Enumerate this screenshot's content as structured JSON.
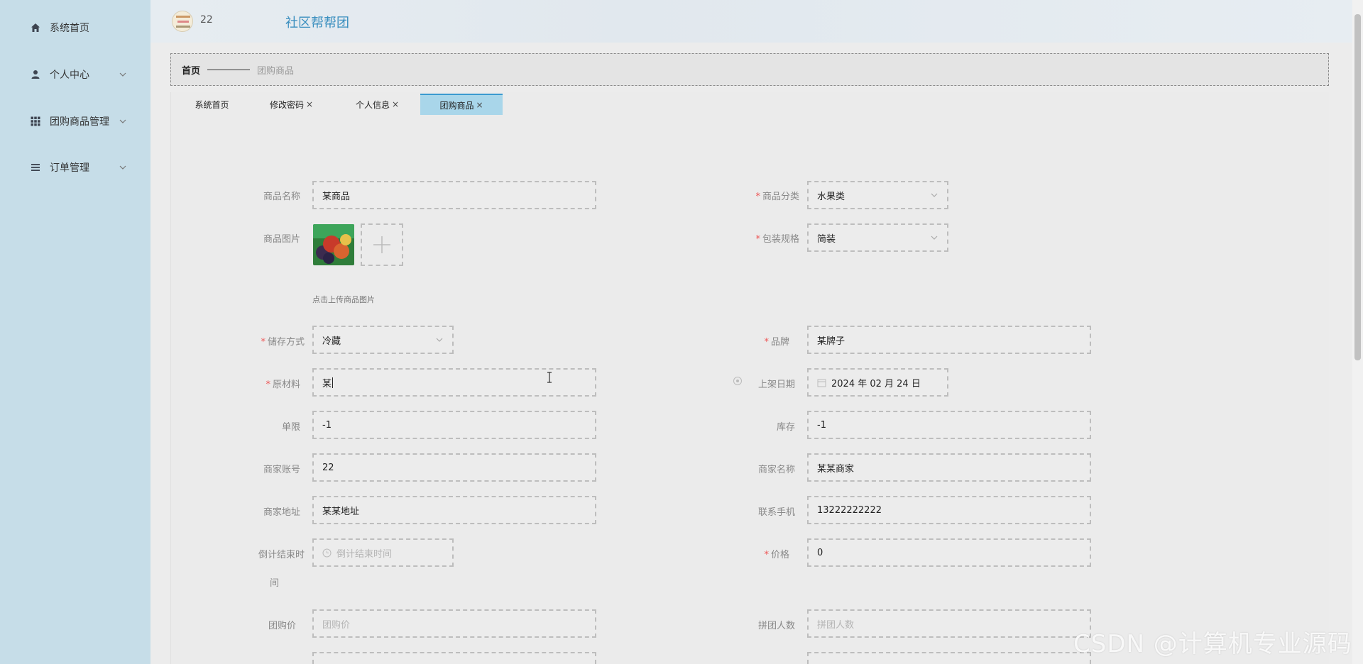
{
  "sidebar": {
    "items": [
      {
        "label": "系统首页",
        "icon": "home-icon"
      },
      {
        "label": "个人中心",
        "icon": "user-icon"
      },
      {
        "label": "团购商品管理",
        "icon": "grid-icon"
      },
      {
        "label": "订单管理",
        "icon": "list-icon"
      }
    ]
  },
  "header": {
    "username": "22",
    "app_title": "社区帮帮团"
  },
  "breadcrumb": {
    "home": "首页",
    "current": "团购商品"
  },
  "tabs": [
    {
      "label": "系统首页",
      "closable": false,
      "active": false
    },
    {
      "label": "修改密码",
      "closable": true,
      "active": false
    },
    {
      "label": "个人信息",
      "closable": true,
      "active": false
    },
    {
      "label": "团购商品",
      "closable": true,
      "active": true
    }
  ],
  "tab_close_glyph": "×",
  "form": {
    "product_name": {
      "label": "商品名称",
      "value": "某商品"
    },
    "category": {
      "label": "商品分类",
      "value": "水果类"
    },
    "image": {
      "label": "商品图片",
      "upload_hint": "点击上传商品图片"
    },
    "packaging": {
      "label": "包装规格",
      "value": "简装"
    },
    "storage": {
      "label": "储存方式",
      "value": "冷藏"
    },
    "brand": {
      "label": "品牌",
      "value": "某牌子"
    },
    "ingredients": {
      "label": "原材料",
      "value": "某"
    },
    "listing_date": {
      "label": "上架日期",
      "value": "2024 年 02 月 24 日"
    },
    "purchase_limit": {
      "label": "单限",
      "value": "-1"
    },
    "stock": {
      "label": "库存",
      "value": "-1"
    },
    "merchant_account": {
      "label": "商家账号",
      "value": "22"
    },
    "merchant_name": {
      "label": "商家名称",
      "value": "某某商家"
    },
    "merchant_address": {
      "label": "商家地址",
      "value": "某某地址"
    },
    "contact_phone": {
      "label": "联系手机",
      "value": "13222222222"
    },
    "countdown_end": {
      "label_line1": "倒计结束时",
      "label_line2": "间",
      "placeholder": "倒计结束时间"
    },
    "price": {
      "label": "价格",
      "value": "0"
    },
    "group_price": {
      "label": "团购价",
      "placeholder": "团购价"
    },
    "group_size": {
      "label": "拼团人数",
      "placeholder": "拼团人数"
    }
  },
  "watermark": "CSDN @计算机专业源码",
  "colors": {
    "sidebar_bg": "#c6dde8",
    "accent": "#3a8fbf",
    "active_tab": "#a9d6ea",
    "required": "#e55555"
  }
}
